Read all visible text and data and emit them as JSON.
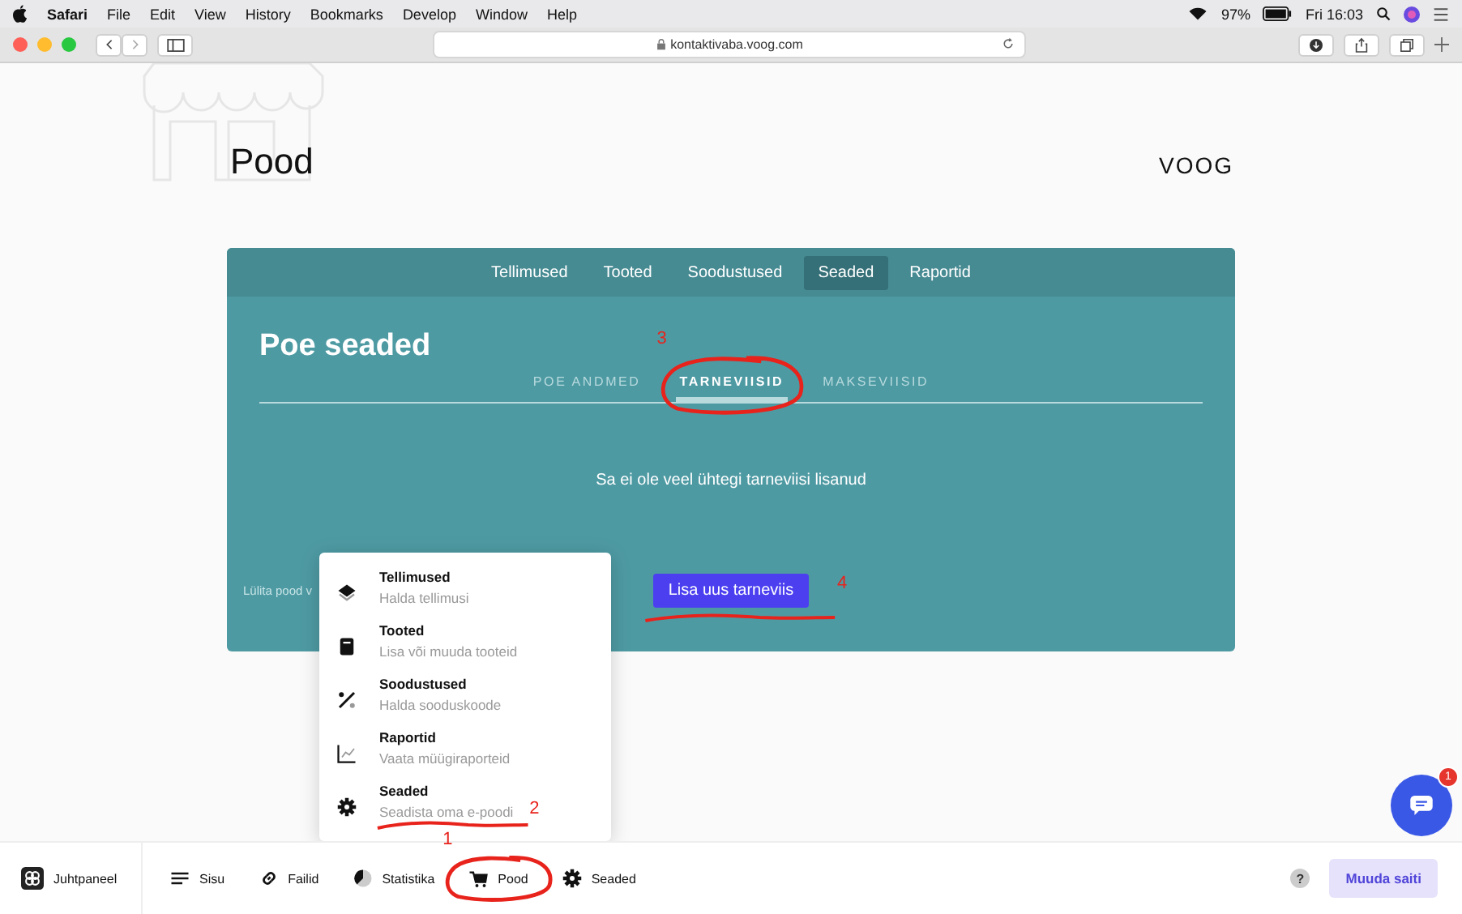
{
  "menubar": {
    "app": "Safari",
    "items": [
      "File",
      "Edit",
      "View",
      "History",
      "Bookmarks",
      "Develop",
      "Window",
      "Help"
    ],
    "battery": "97%",
    "clock": "Fri 16:03"
  },
  "browser": {
    "url": "kontaktivaba.voog.com"
  },
  "page": {
    "title": "Pood",
    "logo": "VOOG"
  },
  "card": {
    "nav": [
      {
        "label": "Tellimused",
        "selected": false
      },
      {
        "label": "Tooted",
        "selected": false
      },
      {
        "label": "Soodustused",
        "selected": false
      },
      {
        "label": "Seaded",
        "selected": true
      },
      {
        "label": "Raportid",
        "selected": false
      }
    ],
    "title": "Poe seaded",
    "subtabs": [
      {
        "label": "POE ANDMED",
        "selected": false
      },
      {
        "label": "TARNEVIISID",
        "selected": true,
        "annotation": {
          "number": "3",
          "kind": "circle"
        }
      },
      {
        "label": "MAKSEVIISID",
        "selected": false
      }
    ],
    "message": "Sa ei ole veel ühtegi tarneviisi lisanud",
    "footer_text": "Lülita pood v",
    "button": {
      "label": "Lisa uus tarneviis",
      "annotation": {
        "number": "4",
        "kind": "underline"
      }
    }
  },
  "popup_menu": {
    "items": [
      {
        "kind": "layers",
        "title": "Tellimused",
        "subtitle": "Halda tellimusi"
      },
      {
        "kind": "box",
        "title": "Tooted",
        "subtitle": "Lisa või muuda tooteid"
      },
      {
        "kind": "percent",
        "title": "Soodustused",
        "subtitle": "Halda sooduskoode"
      },
      {
        "kind": "chart",
        "title": "Raportid",
        "subtitle": "Vaata müügiraporteid"
      },
      {
        "kind": "gear",
        "title": "Seaded",
        "subtitle": "Seadista oma e-poodi",
        "annotation": {
          "number": "2",
          "kind": "underline"
        }
      }
    ]
  },
  "bottom_bar": {
    "brand": "Juhtpaneel",
    "items": [
      {
        "kind": "lines",
        "label": "Sisu"
      },
      {
        "kind": "link",
        "label": "Failid"
      },
      {
        "kind": "pie",
        "label": "Statistika"
      },
      {
        "kind": "cart",
        "label": "Pood",
        "annotation": {
          "number": "1",
          "kind": "circle"
        }
      },
      {
        "kind": "gear",
        "label": "Seaded"
      }
    ],
    "help": "?",
    "action": "Muuda saiti"
  },
  "chat": {
    "badge": "1"
  }
}
